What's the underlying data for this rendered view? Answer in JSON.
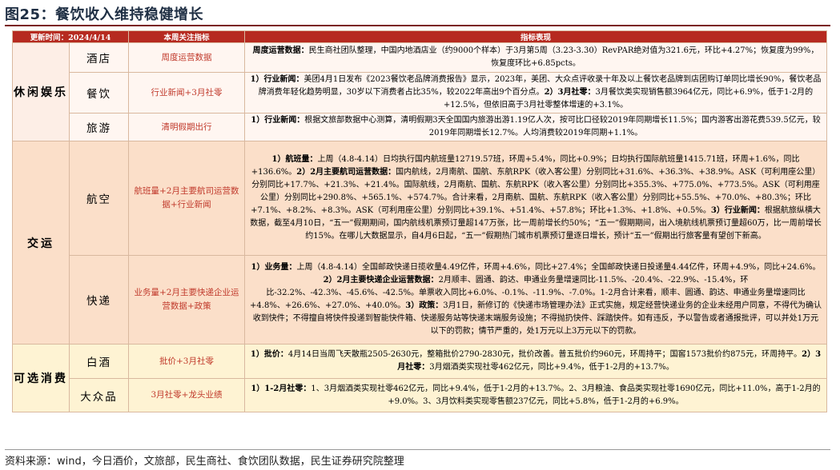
{
  "figure_title": "图25：餐饮收入维持稳健增长",
  "header": {
    "col1": "更新时间：2024/4/14",
    "col2": "本周关注指标",
    "col3": "指标表现"
  },
  "groups": [
    {
      "category": "休闲娱乐",
      "rows": [
        {
          "name": "酒店",
          "indicator": "周度运营数据",
          "perf_lead": "周度运营数据：",
          "perf": "民生商社团队整理，中国内地酒店业（约9000个样本）于3月第5周（3.23-3.30）RevPAR绝对值为321.6元，环比+4.27%；恢复度为99%，恢复度环比+6.85pcts。"
        },
        {
          "name": "餐饮",
          "indicator": "行业新闻+3月社零",
          "perf_lead": "1）行业新闻：",
          "perf": "美团4月1日发布《2023餐饮老品牌消费报告》显示，2023年，美团、大众点评收录十年及以上餐饮老品牌到店团购订单同比增长90%，餐饮老品牌消费年轻化趋势明显，30岁以下消费者占比35%，较2022年高出9个百分点。",
          "perf_lead2": "2）3月社零：",
          "perf2": "3月餐饮类实现销售额3964亿元，同比+6.9%，低于1-2月的+12.5%，但依旧高于3月社零整体增速的+3.1%。"
        },
        {
          "name": "旅游",
          "indicator": "清明假期出行",
          "perf_lead": "1）行业新闻：",
          "perf": "根据文旅部数据中心测算，清明假期3天全国国内旅游出游1.19亿人次，按可比口径较2019年同期增长11.5%；国内游客出游花费539.5亿元，较2019年同期增长12.7%。人均消费较2019年同期+1.1%。"
        }
      ]
    },
    {
      "category": "交运",
      "rows": [
        {
          "name": "航空",
          "indicator": "航班量+2月主要航司运营数据+行业新闻",
          "perf_lead": "1）航班量：",
          "perf": "上周（4.8-4.14）日均执行国内航班量12719.57班，环周+5.4%，同比+0.9%；日均执行国际航班量1415.71班，环周+1.6%，同比+136.6%。",
          "perf_lead2": "2）2月主要航司运营数据：",
          "perf2": "国内航线，2月南航、国航、东航RPK（收入客公里）分别同比+31.6%、+36.3%、+38.9%。ASK（可利用座公里）分别同比+17.7%、+21.3%、+21.4%。国际航线，2月南航、国航、东航RPK（收入客公里）分别同比+355.3%、+775.0%、+773.5%。ASK（可利用座公里）分别同比+290.8%、+565.1%、+574.7%。合计来看，2月南航、国航、东航RPK（收入客公里）分别同比+55.5%、+70.0%、+80.3%；环比+7.1%、+8.2%、+8.3%。ASK（可利用座公里）分别同比+39.1%、+51.4%、+57.8%；环比+1.3%、+1.8%、+0.5%。",
          "perf_lead3": "3）行业新闻：",
          "perf3": "根据航旅纵横大数据，截至4月10日，“五一”假期期间，国内航线机票预订量超147万张，比一周前增长约50%；“五一”假期期间，出入境航线机票预订量超60万，比一周前增长约15%。在哪儿大数据显示，自4月6日起，“五一”假期热门城市机票预订量逐日增长，预计“五一”假期出行旅客量有望创下新高。"
        },
        {
          "name": "快递",
          "indicator": "业务量+2月主要快递企业运营数据+政策",
          "perf_lead": "1）业务量：",
          "perf": "上周（4.8-4.14）全国邮政快递日揽收量4.49亿件，环周+4.6%，同比+27.4%；全国邮政快递日投递量4.44亿件，环周+4.9%，同比+24.6%。",
          "perf_lead2": "2）2月主要快递企业运营数据：",
          "perf2": "2月顺丰、圆通、韵达、申通业务量增速同比-11.5%、-20.4%、-22.9%、-15.4%，环比-32.2%、-42.3%、-45.6%、-42.5%。单票收入同比+6.0%、-0.1%、-11.9%、-7.0%。1-2月合计来看，顺丰、圆通、韵达、申通业务量增速同比+4.8%、+26.6%、+27.0%、+40.0%。",
          "perf_lead3": "3）政策：",
          "perf3": "3月1日，新修订的《快递市场管理办法》正式实施，规定经营快递业务的企业未经用户同意，不得代为确认收到快件；不得擅自将快件投递到智能快件箱、快递服务站等快递末端服务设施；不得抛扔快件、踩踏快件。如有违反，予以警告或者通报批评，可以并处1万元以下的罚款；情节严重的，处1万元以上3万元以下的罚款。"
        }
      ]
    },
    {
      "category": "可选消费",
      "rows": [
        {
          "name": "白酒",
          "indicator": "批价+3月社零",
          "perf_lead": "1）批价：",
          "perf": "4月14日当周飞天散瓶2505-2630元，整箱批价2790-2830元，批价改善。普五批价约960元，环周持平；国窖1573批价约875元，环周持平。",
          "perf_lead2": "2）3月社零：",
          "perf2": "3月烟酒类实现社零462亿元，同比+9.4%，低于1-2月的+13.7%。"
        },
        {
          "name": "大众品",
          "indicator": "3月社零+龙头业绩",
          "perf_lead": "1）1-2月社零：",
          "perf": "1、3月烟酒类实现社零462亿元，同比+9.4%，低于1-2月的+13.7%。2、3月粮油、食品类实现社零1690亿元，同比+11.0%，高于1-2月的+9.0%。3、3月饮料类实现零售额237亿元，同比+5.8%，低于1-2月的+6.9%。"
        }
      ]
    }
  ],
  "source": "资料来源：wind，今日酒价，文旅部，民生商社、食饮团队数据，民生证券研究院整理"
}
